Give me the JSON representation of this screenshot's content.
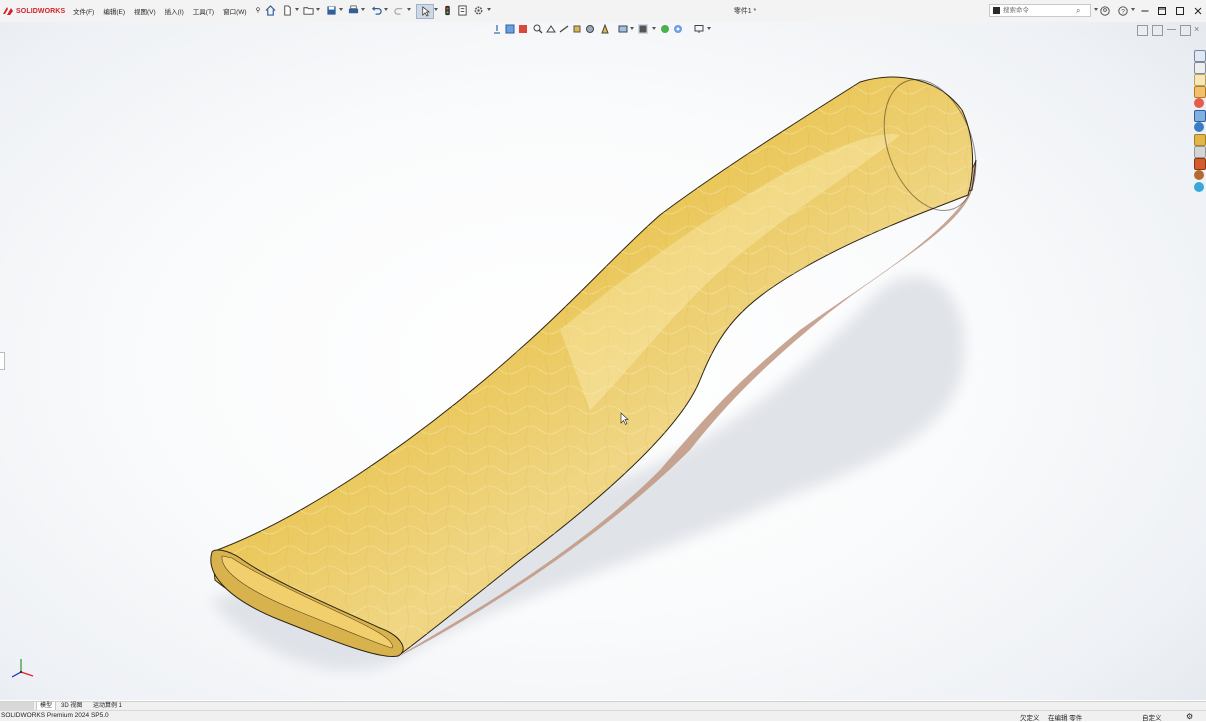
{
  "app": {
    "brand": "SOLIDWORKS",
    "document_title": "零件1 *",
    "accent_color": "#d2232a"
  },
  "menu": {
    "items": [
      "文件(F)",
      "编辑(E)",
      "视图(V)",
      "插入(I)",
      "工具(T)",
      "窗口(W)"
    ]
  },
  "search": {
    "placeholder": "搜索命令"
  },
  "tabs": {
    "items": [
      "模型",
      "3D 视图",
      "运动算例 1"
    ]
  },
  "status": {
    "product": "SOLIDWORKS Premium 2024 SP5.0",
    "undefined": "欠定义",
    "editing": "在编辑 零件",
    "custom": "自定义"
  },
  "model": {
    "material_color": "#e8c24a",
    "shadow_side_color": "#c99a86"
  }
}
